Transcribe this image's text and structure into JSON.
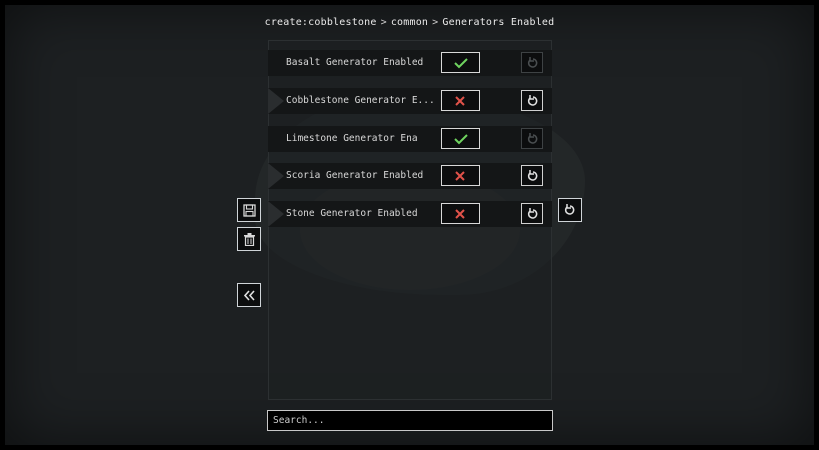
{
  "breadcrumb": {
    "part1": "create:cobblestone",
    "part2": "common",
    "part3": "Generators Enabled"
  },
  "options": [
    {
      "label": "Basalt Generator Enabled",
      "value": true
    },
    {
      "label": "Cobblestone Generator E...",
      "value": false
    },
    {
      "label": "Limestone Generator Ena",
      "value": true
    },
    {
      "label": "Scoria Generator Enabled",
      "value": false
    },
    {
      "label": "Stone Generator Enabled",
      "value": false
    }
  ],
  "search": {
    "placeholder": "Search..."
  },
  "icons": {
    "save": "save-icon",
    "delete": "trash-icon",
    "back": "double-chevron-left-icon",
    "reset": "reset-icon",
    "check": "check-icon",
    "cross": "cross-icon"
  },
  "colors": {
    "check": "#6fd35f",
    "cross": "#e0524a",
    "background": "#1d2022"
  }
}
